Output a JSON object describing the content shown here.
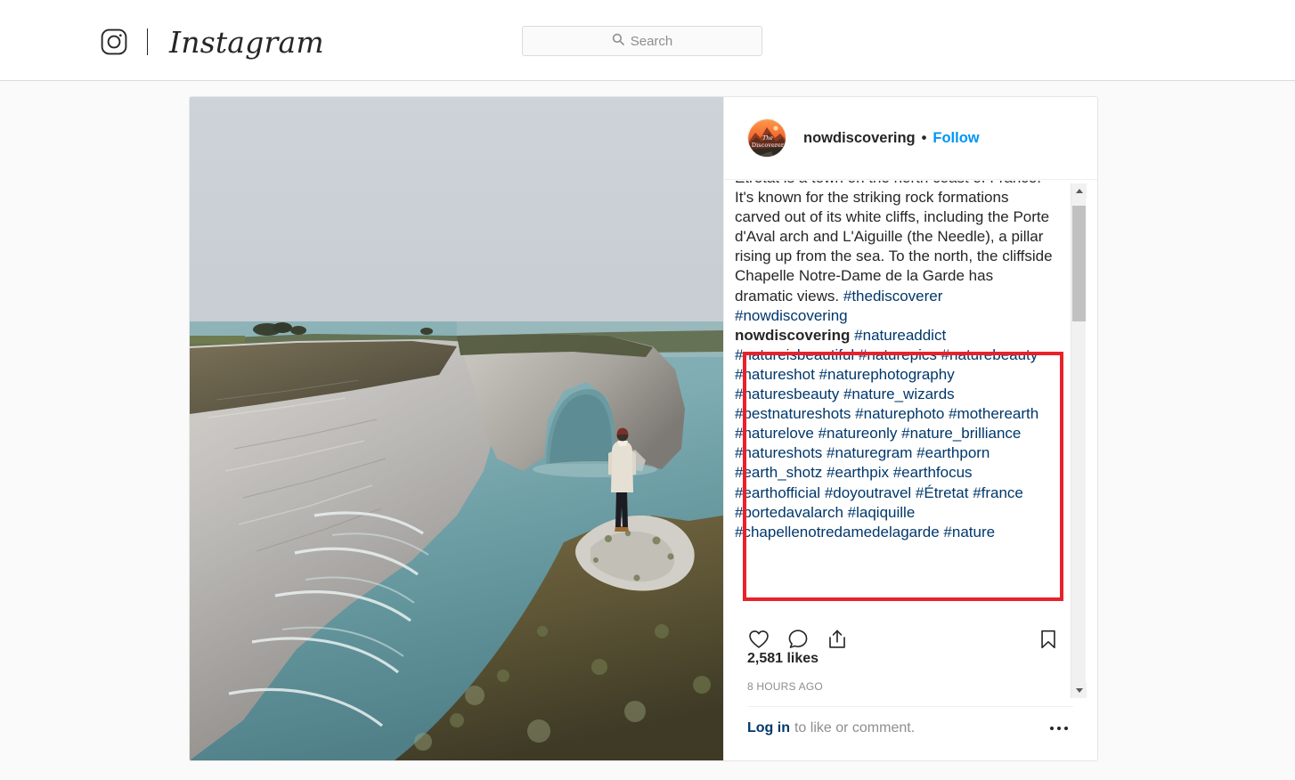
{
  "header": {
    "camera_icon": "instagram-camera-icon",
    "wordmark": "Instagram",
    "search": {
      "icon": "search-icon",
      "placeholder": "Search",
      "value": ""
    }
  },
  "post": {
    "image_alt": "Person standing on a cliff edge overlooking the sea and the white chalk cliffs with the Porte d'Aval arch at Étretat, France",
    "avatar_alt": "The Discoverer logo - mountain sunset",
    "author": "nowdiscovering",
    "separator": "•",
    "follow_label": "Follow",
    "caption": {
      "author_inline": "",
      "text_before_tags": "Étretat is a town on the north coast of France. It's known for the striking rock formations carved out of its white cliffs, including the Porte d'Aval arch and L'Aiguille (the Needle), a pillar rising up from the sea. To the north, the cliffside Chapelle Notre-Dame de la Garde has dramatic views. ",
      "caption_tags": [
        "#thediscoverer",
        "#nowdiscovering"
      ]
    },
    "hashtag_comment": {
      "username": "nowdiscovering",
      "tags": [
        "#natureaddict",
        "#natureisbeautiful",
        "#naturepics",
        "#naturebeauty",
        "#natureshot",
        "#naturephotography",
        "#naturesbeauty",
        "#nature_wizards",
        "#bestnatureshots",
        "#naturephoto",
        "#motherearth",
        "#naturelove",
        "#natureonly",
        "#nature_brilliance",
        "#natureshots",
        "#naturegram",
        "#earthporn",
        "#earth_shotz",
        "#earthpix",
        "#earthfocus",
        "#earthofficial",
        "#doyoutravel",
        "#Étretat",
        "#france",
        "#portedavalarch",
        "#laqiquille",
        "#chapellenotredamedelagarde",
        "#nature"
      ]
    },
    "actions": {
      "like_icon": "heart-icon",
      "comment_icon": "speech-bubble-icon",
      "share_icon": "share-icon",
      "save_icon": "bookmark-icon"
    },
    "likes": "2,581 likes",
    "timestamp": "8 HOURS AGO",
    "login_prompt": {
      "link": "Log in",
      "rest": "to like or comment."
    },
    "more_icon": "more-options-icon"
  },
  "scrollbar": {
    "up_icon": "scroll-up-arrow-icon",
    "down_icon": "scroll-down-arrow-icon",
    "thumb": "scroll-thumb"
  },
  "annotation": {
    "highlight_color": "#e8212a",
    "label": "hashtag-highlight-box"
  },
  "colors": {
    "accent_blue": "#0095f6",
    "link_blue": "#00376b",
    "text": "#262626",
    "muted": "#8e8e8e",
    "page_bg": "#fafafa",
    "border": "#dbdbdb"
  }
}
